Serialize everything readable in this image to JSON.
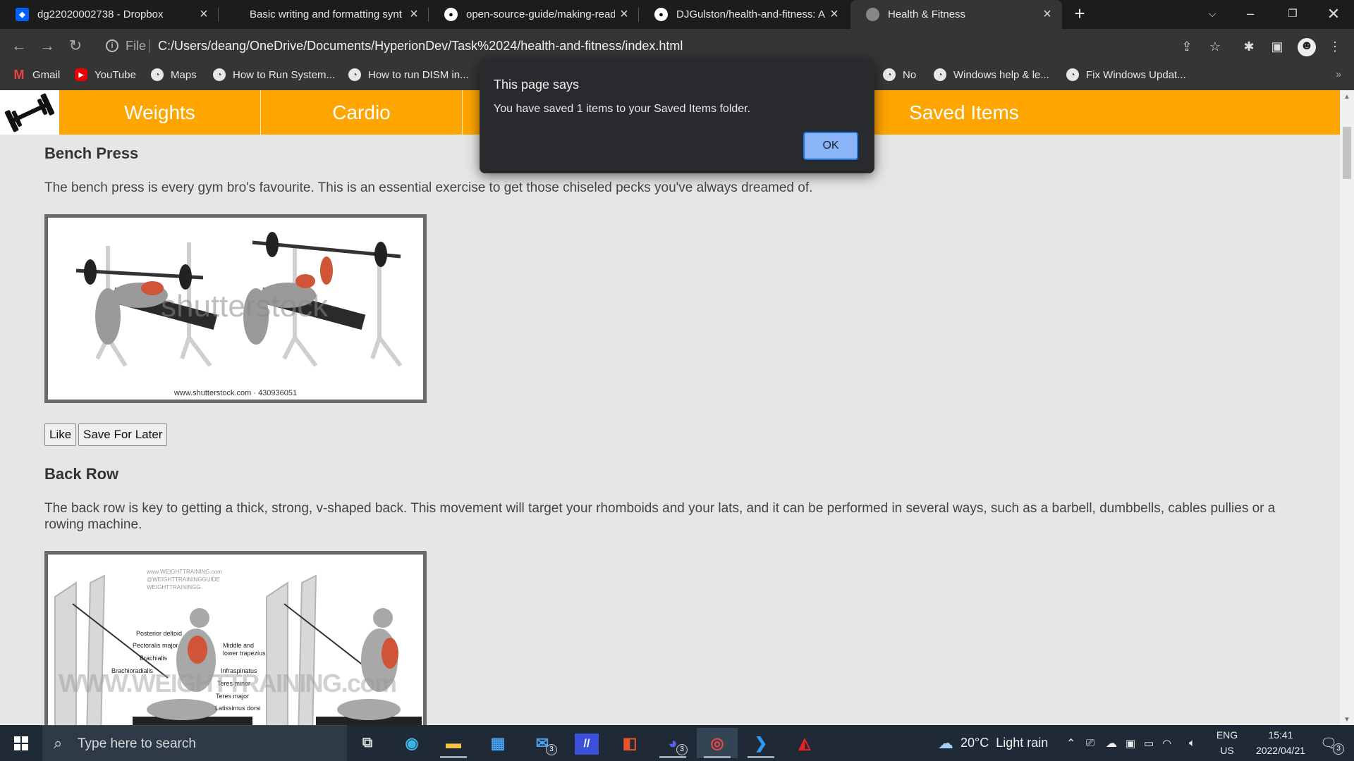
{
  "browser": {
    "tabs": [
      {
        "title": "dg22020002738 - Dropbox",
        "icon": "dropbox-icon",
        "color": "#0061fe"
      },
      {
        "title": "Basic writing and formatting synt",
        "icon": "github-icon",
        "color": "#1c1c1c"
      },
      {
        "title": "open-source-guide/making-read",
        "icon": "github-icon",
        "color": "#ffffff"
      },
      {
        "title": "DJGulston/health-and-fitness: A",
        "icon": "github-icon",
        "color": "#ffffff"
      },
      {
        "title": "Health & Fitness",
        "icon": "globe-icon",
        "color": "#888888"
      }
    ],
    "address": {
      "scheme_label": "File",
      "url": "C:/Users/deang/OneDrive/Documents/HyperionDev/Task%2024/health-and-fitness/index.html"
    },
    "bookmarks": [
      {
        "label": "Gmail",
        "icon": "gmail-icon"
      },
      {
        "label": "YouTube",
        "icon": "youtube-icon"
      },
      {
        "label": "Maps",
        "icon": "globe-icon"
      },
      {
        "label": "How to Run System...",
        "icon": "globe-icon"
      },
      {
        "label": "How to run DISM in...",
        "icon": "globe-icon"
      },
      {
        "label": "No",
        "icon": "globe-icon"
      },
      {
        "label": "Windows help & le...",
        "icon": "globe-icon"
      },
      {
        "label": "Fix Windows Updat...",
        "icon": "globe-icon"
      }
    ]
  },
  "site": {
    "nav": [
      "Weights",
      "Cardio",
      "Saved Items"
    ],
    "accent_color": "#ffa500",
    "sections": [
      {
        "title": "Bench Press",
        "text": "The bench press is every gym bro's favourite. This is an essential exercise to get those chiseled pecks you've always dreamed of.",
        "image_caption": "www.shutterstock.com · 430936051",
        "image_watermark": "shutterstock"
      },
      {
        "title": "Back Row",
        "text": "The back row is key to getting a thick, strong, v-shaped back. This movement will target your rhomboids and your lats, and it can be performed in several ways, such as a barbell, dumbbells, cables pullies or a rowing machine.",
        "image_header": [
          "www.WEIGHTTRAINING.com",
          "@WEIGHTTRAININGGUIDE",
          "WEIGHTTRAININGG"
        ],
        "image_labels_left": [
          "Posterior deltoid",
          "Pectoralis major",
          "Brachialis",
          "Brachioradialis"
        ],
        "image_labels_right": [
          "Middle and",
          "lower trapezius",
          "Infraspinatus",
          "Teres minor",
          "Teres major",
          "Latissimus dorsi"
        ],
        "image_watermark": "WWW.WEIGHTTRAINING.com"
      }
    ],
    "buttons": {
      "like": "Like",
      "save": "Save For Later"
    }
  },
  "dialog": {
    "title": "This page says",
    "message": "You have saved 1 items to your Saved Items folder.",
    "ok": "OK"
  },
  "taskbar": {
    "search_placeholder": "Type here to search",
    "mail_badge": "3",
    "discord_badge": "3",
    "notification_badge": "3",
    "weather": "20°C  Light rain",
    "language": "ENG",
    "region": "US",
    "time": "15:41",
    "date": "2022/04/21"
  }
}
